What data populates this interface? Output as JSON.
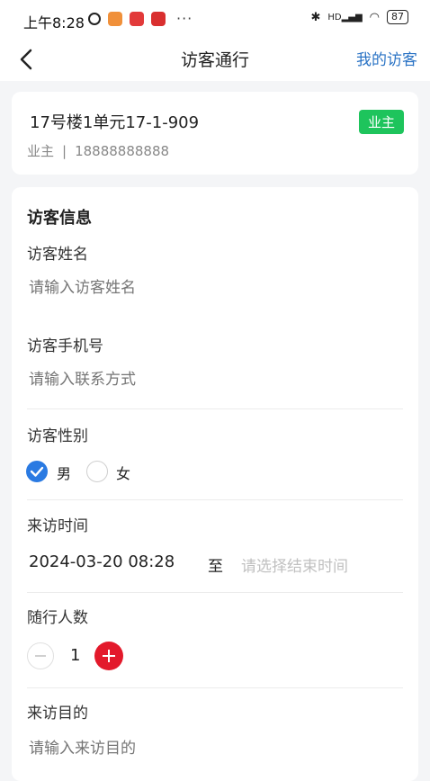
{
  "status_bar": {
    "time": "上午8:28",
    "network": "HD",
    "battery": "87",
    "more": "···"
  },
  "nav": {
    "title": "访客通行",
    "right_link": "我的访客"
  },
  "owner_card": {
    "address": "17号楼1单元17-1-909",
    "role_badge": "业主",
    "role": "业主",
    "separator": "|",
    "phone": "18888888888"
  },
  "visitor_form": {
    "section_title": "访客信息",
    "name_label": "访客姓名",
    "name_placeholder": "请输入访客姓名",
    "phone_label": "访客手机号",
    "phone_placeholder": "请输入联系方式",
    "gender_label": "访客性别",
    "gender_options": [
      "男",
      "女"
    ],
    "gender_selected": "男",
    "time_label": "来访时间",
    "start_time": "2024-03-20 08:28",
    "to_text": "至",
    "end_time_placeholder": "请选择结束时间",
    "companions_label": "随行人数",
    "companions_count": "1",
    "purpose_label": "来访目的",
    "purpose_placeholder": "请输入来访目的"
  },
  "colors": {
    "accent_blue": "#2a73c5",
    "badge_green": "#1ec45c",
    "plus_red": "#e3192b",
    "radio_blue": "#2a7ae2"
  }
}
